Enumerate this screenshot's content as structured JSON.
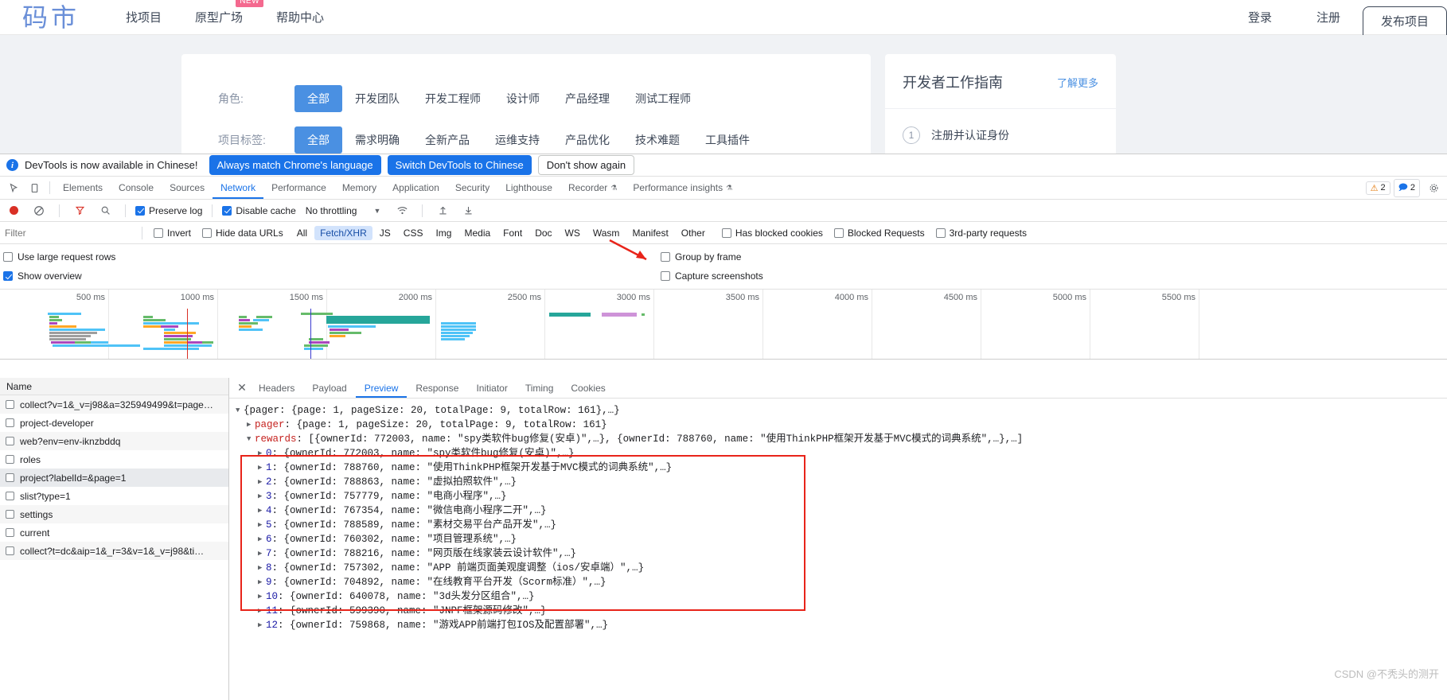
{
  "site": {
    "logo": "码市",
    "nav": [
      {
        "label": "找项目",
        "badge": ""
      },
      {
        "label": "原型广场",
        "badge": "NEW"
      },
      {
        "label": "帮助中心",
        "badge": ""
      }
    ],
    "login": "登录",
    "register": "注册",
    "publish": "发布项目"
  },
  "filters": [
    {
      "label": "角色:",
      "options": [
        "全部",
        "开发团队",
        "开发工程师",
        "设计师",
        "产品经理",
        "测试工程师"
      ],
      "selected": "全部"
    },
    {
      "label": "项目标签:",
      "options": [
        "全部",
        "需求明确",
        "全新产品",
        "运维支持",
        "产品优化",
        "技术难题",
        "工具插件"
      ],
      "selected": "全部"
    }
  ],
  "guide": {
    "title": "开发者工作指南",
    "more": "了解更多",
    "steps": [
      {
        "num": "1",
        "text": "注册并认证身份"
      }
    ]
  },
  "devtools": {
    "banner": {
      "message": "DevTools is now available in Chinese!",
      "primary": "Always match Chrome's language",
      "secondary": "Switch DevTools to Chinese",
      "dismiss": "Don't show again",
      "info_icon": "info-icon"
    },
    "tabs": [
      {
        "label": "Elements",
        "active": false
      },
      {
        "label": "Console",
        "active": false
      },
      {
        "label": "Sources",
        "active": false
      },
      {
        "label": "Network",
        "active": true
      },
      {
        "label": "Performance",
        "active": false
      },
      {
        "label": "Memory",
        "active": false
      },
      {
        "label": "Application",
        "active": false
      },
      {
        "label": "Security",
        "active": false
      },
      {
        "label": "Lighthouse",
        "active": false
      },
      {
        "label": "Recorder",
        "active": false,
        "beta": true
      },
      {
        "label": "Performance insights",
        "active": false,
        "beta": true
      }
    ],
    "counters": {
      "warnings": "2",
      "messages": "2"
    },
    "toolbar": {
      "preserve_log": "Preserve log",
      "preserve_log_checked": true,
      "disable_cache": "Disable cache",
      "disable_cache_checked": true,
      "throttling": "No throttling",
      "record_icon": "record-icon",
      "clear_icon": "clear-icon",
      "filter_icon": "filter-icon",
      "search_icon": "search-icon",
      "wifi_icon": "network-conditions-icon",
      "import_icon": "import-har-icon",
      "export_icon": "export-har-icon"
    },
    "filterbar": {
      "placeholder": "Filter",
      "invert": "Invert",
      "hide_data_urls": "Hide data URLs",
      "types": [
        "All",
        "Fetch/XHR",
        "JS",
        "CSS",
        "Img",
        "Media",
        "Font",
        "Doc",
        "WS",
        "Wasm",
        "Manifest",
        "Other"
      ],
      "active_type": "Fetch/XHR",
      "has_blocked_cookies": "Has blocked cookies",
      "blocked_requests": "Blocked Requests",
      "third_party": "3rd-party requests"
    },
    "options": {
      "large_rows": "Use large request rows",
      "large_rows_checked": false,
      "show_overview": "Show overview",
      "show_overview_checked": true,
      "group_by_frame": "Group by frame",
      "group_by_frame_checked": false,
      "capture_screenshots": "Capture screenshots",
      "capture_screenshots_checked": false
    },
    "overview_ticks": [
      "500 ms",
      "1000 ms",
      "1500 ms",
      "2000 ms",
      "2500 ms",
      "3000 ms",
      "3500 ms",
      "4000 ms",
      "4500 ms",
      "5000 ms",
      "5500 ms"
    ],
    "requests_header": "Name",
    "requests": [
      {
        "name": "collect?v=1&_v=j98&a=325949499&t=page…",
        "selected": false
      },
      {
        "name": "project-developer",
        "selected": false
      },
      {
        "name": "web?env=env-iknzbddq",
        "selected": false
      },
      {
        "name": "roles",
        "selected": false
      },
      {
        "name": "project?labelId=&page=1",
        "selected": true
      },
      {
        "name": "slist?type=1",
        "selected": false
      },
      {
        "name": "settings",
        "selected": false
      },
      {
        "name": "current",
        "selected": false
      },
      {
        "name": "collect?t=dc&aip=1&_r=3&v=1&_v=j98&ti…",
        "selected": false
      }
    ],
    "detail_tabs": [
      {
        "label": "Headers",
        "active": false
      },
      {
        "label": "Payload",
        "active": false
      },
      {
        "label": "Preview",
        "active": true
      },
      {
        "label": "Response",
        "active": false
      },
      {
        "label": "Initiator",
        "active": false
      },
      {
        "label": "Timing",
        "active": false
      },
      {
        "label": "Cookies",
        "active": false
      }
    ],
    "preview_lines": [
      {
        "indent": 0,
        "tri": "▼",
        "text": "{pager: {page: 1, pageSize: 20, totalPage: 9, totalRow: 161},…}"
      },
      {
        "indent": 1,
        "tri": "▶",
        "key": "pager",
        "text": ": {page: 1, pageSize: 20, totalPage: 9, totalRow: 161}"
      },
      {
        "indent": 1,
        "tri": "▼",
        "key": "rewards",
        "text": ": [{ownerId: 772003, name: \"spy类软件bug修复(安卓)\",…}, {ownerId: 788760, name: \"使用ThinkPHP框架开发基于MVC模式的词典系统\",…},…]"
      },
      {
        "indent": 2,
        "tri": "▶",
        "key": "0",
        "text": ": {ownerId: 772003, name: \"spy类软件bug修复(安卓)\",…}"
      },
      {
        "indent": 2,
        "tri": "▶",
        "key": "1",
        "text": ": {ownerId: 788760, name: \"使用ThinkPHP框架开发基于MVC模式的词典系统\",…}"
      },
      {
        "indent": 2,
        "tri": "▶",
        "key": "2",
        "text": ": {ownerId: 788863, name: \"虚拟拍照软件\",…}"
      },
      {
        "indent": 2,
        "tri": "▶",
        "key": "3",
        "text": ": {ownerId: 757779, name: \"电商小程序\",…}"
      },
      {
        "indent": 2,
        "tri": "▶",
        "key": "4",
        "text": ": {ownerId: 767354, name: \"微信电商小程序二开\",…}"
      },
      {
        "indent": 2,
        "tri": "▶",
        "key": "5",
        "text": ": {ownerId: 788589, name: \"素材交易平台产品开发\",…}"
      },
      {
        "indent": 2,
        "tri": "▶",
        "key": "6",
        "text": ": {ownerId: 760302, name: \"项目管理系统\",…}"
      },
      {
        "indent": 2,
        "tri": "▶",
        "key": "7",
        "text": ": {ownerId: 788216, name: \"网页版在线家装云设计软件\",…}"
      },
      {
        "indent": 2,
        "tri": "▶",
        "key": "8",
        "text": ": {ownerId: 757302, name: \"APP 前端页面美观度调整（ios/安卓端）\",…}"
      },
      {
        "indent": 2,
        "tri": "▶",
        "key": "9",
        "text": ": {ownerId: 704892, name: \"在线教育平台开发（Scorm标准）\",…}"
      },
      {
        "indent": 2,
        "tri": "▶",
        "key": "10",
        "text": ": {ownerId: 640078, name: \"3d头发分区组合\",…}"
      },
      {
        "indent": 2,
        "tri": "▶",
        "key": "11",
        "text": ": {ownerId: 599390, name: \"JNPF框架源码修改\",…}"
      },
      {
        "indent": 2,
        "tri": "▶",
        "key": "12",
        "text": ": {ownerId: 759868, name: \"游戏APP前端打包IOS及配置部署\",…}"
      }
    ],
    "watermark": "CSDN @不秃头的测开"
  }
}
